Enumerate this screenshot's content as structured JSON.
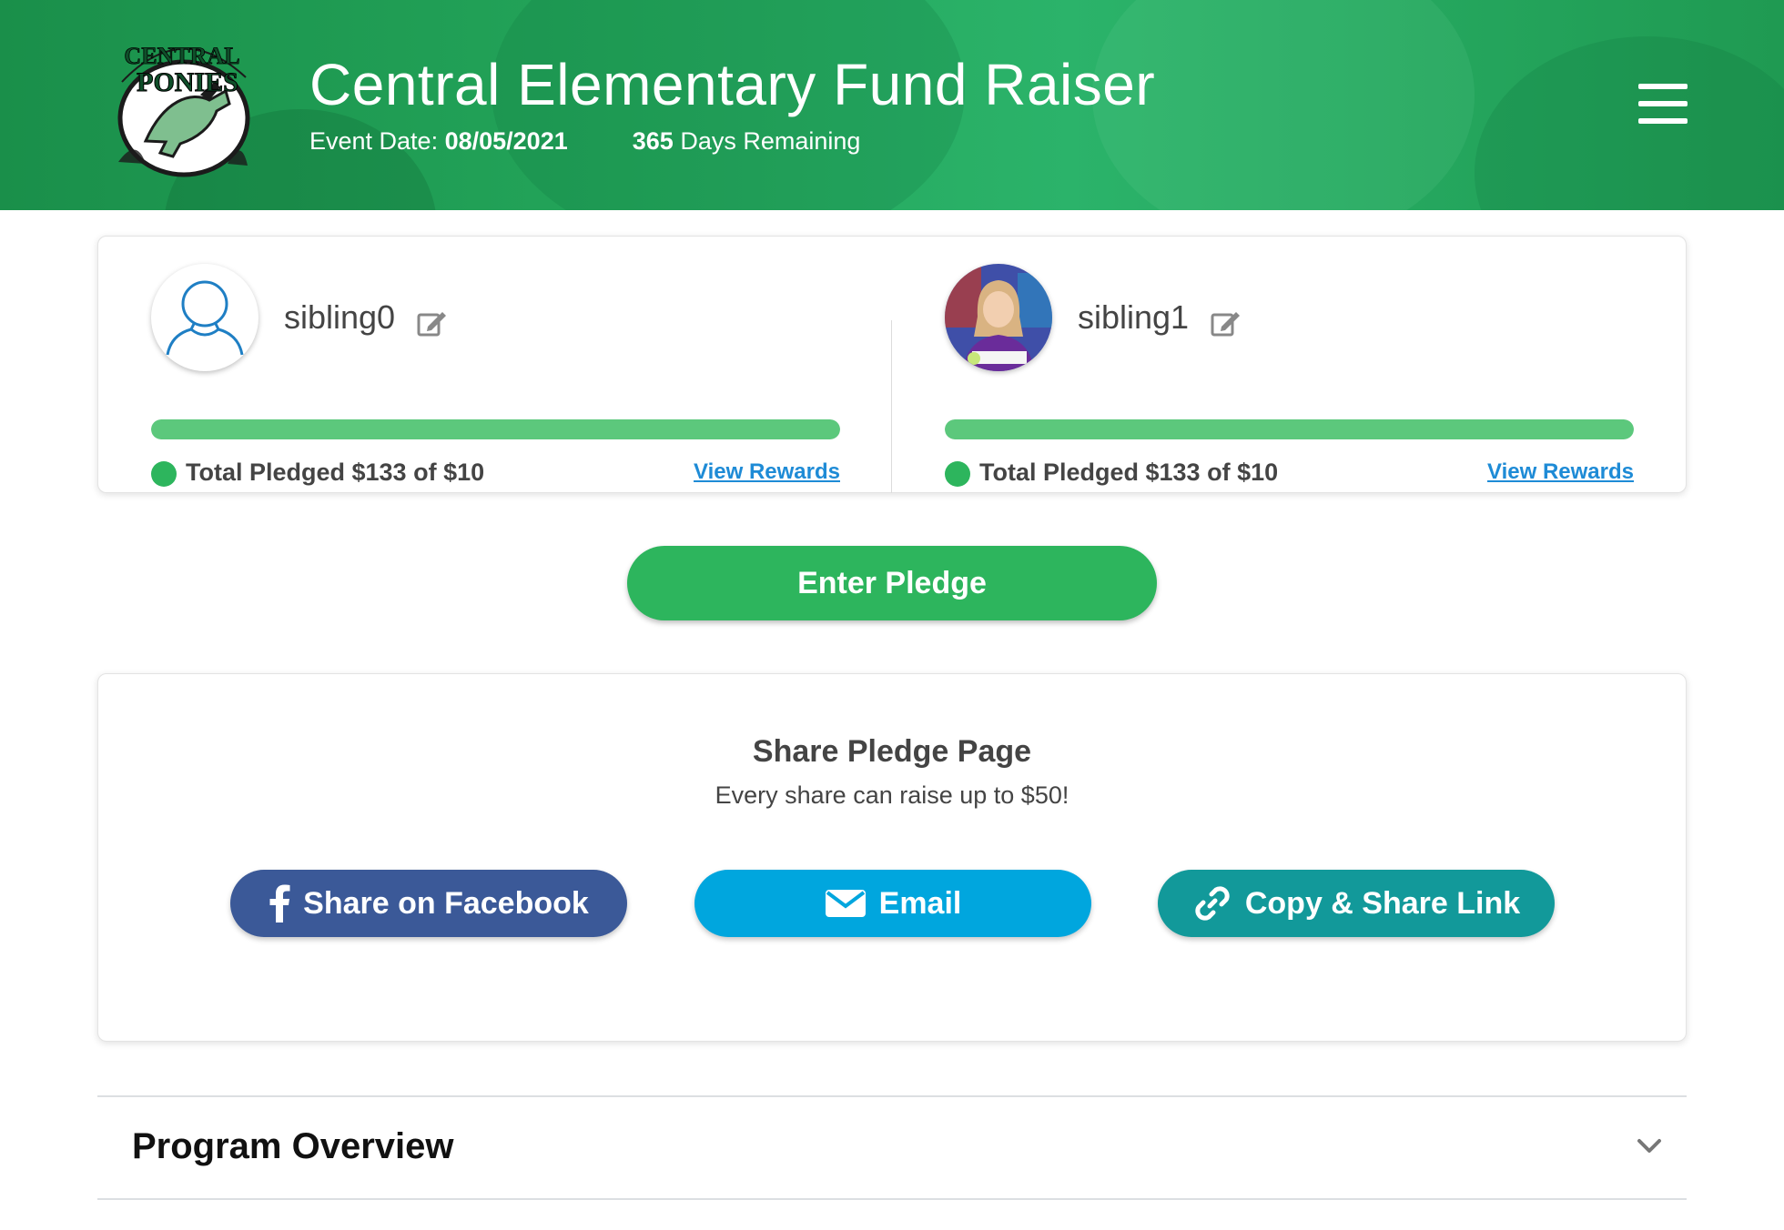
{
  "header": {
    "title": "Central Elementary Fund Raiser",
    "event_date_label": "Event Date:",
    "event_date": "08/05/2021",
    "days_remaining_count": "365",
    "days_remaining_label": "Days Remaining",
    "logo_text_top": "CENTRAL",
    "logo_text_bottom": "PONIES"
  },
  "siblings": [
    {
      "name": "sibling0",
      "avatar": "user-outline-icon",
      "pledged_text": "Total Pledged $133 of $10",
      "progress_percent": 100,
      "rewards_label": "View Rewards"
    },
    {
      "name": "sibling1",
      "avatar": "student-photo",
      "pledged_text": "Total Pledged $133 of $10",
      "progress_percent": 100,
      "rewards_label": "View Rewards"
    }
  ],
  "enter_pledge_label": "Enter Pledge",
  "share": {
    "title": "Share Pledge Page",
    "subtitle": "Every share can raise up to $50!",
    "facebook_label": "Share on Facebook",
    "email_label": "Email",
    "copy_label": "Copy & Share Link"
  },
  "overview": {
    "title": "Program Overview"
  },
  "colors": {
    "header_green": "#23a55a",
    "progress_green": "#5cc87c",
    "button_green": "#2db55d",
    "link_blue": "#1e8bd6",
    "facebook_blue": "#3b5998",
    "email_blue": "#00a6de",
    "copy_teal": "#12999a"
  }
}
